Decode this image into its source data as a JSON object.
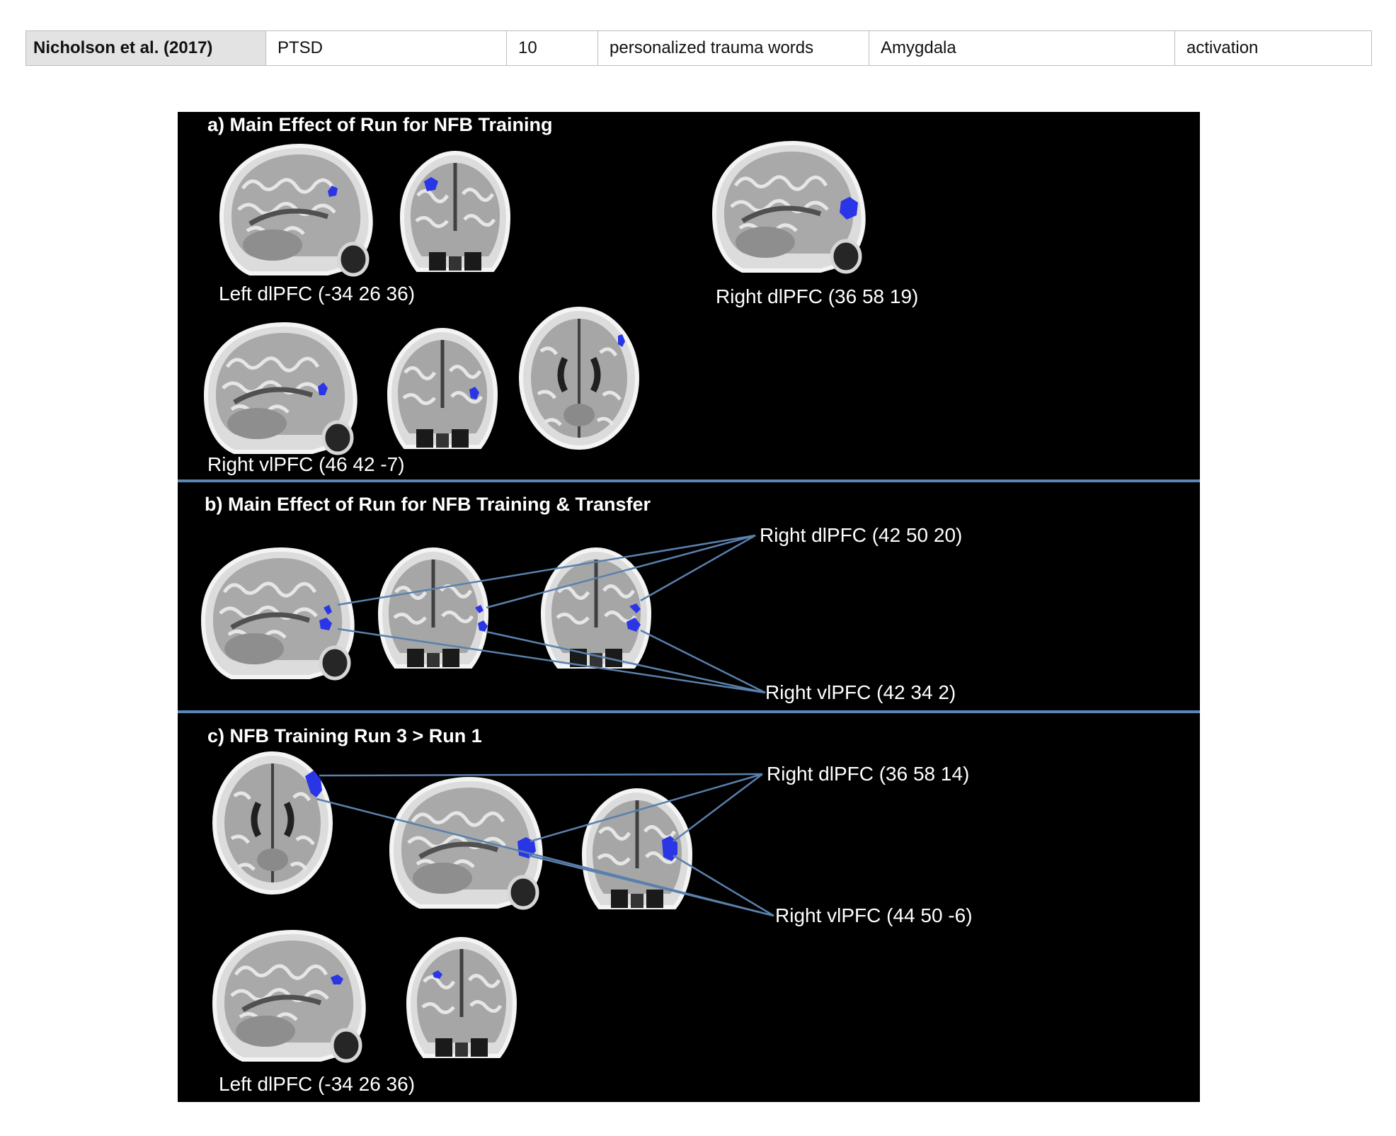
{
  "table_row": {
    "study": "Nicholson et al. (2017)",
    "population": "PTSD",
    "n": "10",
    "paradigm": "personalized trauma words",
    "target_region": "Amygdala",
    "direction": "activation"
  },
  "figure": {
    "colors": {
      "background": "#000000",
      "divider": "#5b87b8",
      "activation": "#2a35e6",
      "connector": "#5a80ad"
    },
    "panel_a": {
      "title": "a) Main Effect of Run for NFB Training",
      "labels": [
        "Left dlPFC (-34 26 36)",
        "Right dlPFC (36 58 19)",
        "Right vlPFC (46 42 -7)"
      ]
    },
    "panel_b": {
      "title": "b) Main Effect of Run for NFB Training & Transfer",
      "labels": [
        "Right dlPFC (42 50 20)",
        "Right vlPFC (42 34 2)"
      ]
    },
    "panel_c": {
      "title": "c) NFB Training Run 3 > Run 1",
      "labels": [
        "Right dlPFC (36 58 14)",
        "Right vlPFC (44 50 -6)",
        "Left dlPFC (-34 26 36)"
      ]
    }
  }
}
